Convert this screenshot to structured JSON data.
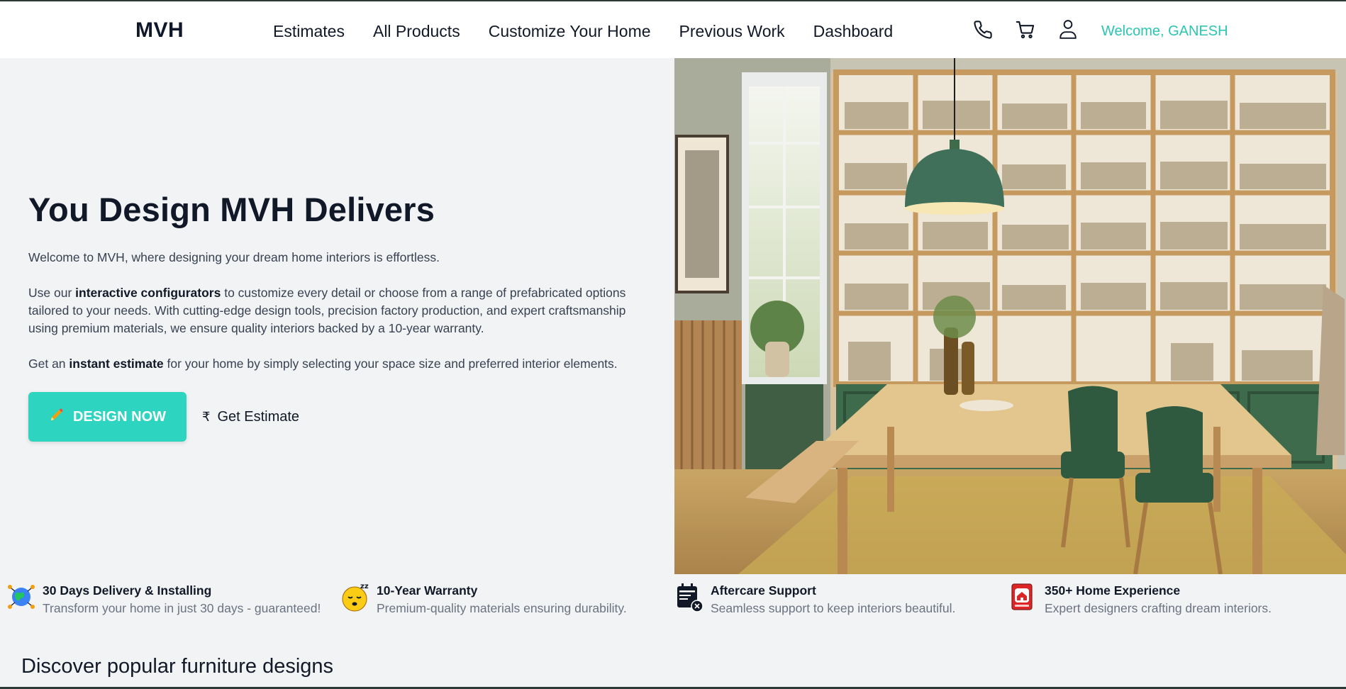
{
  "brand": {
    "logo": "MVH",
    "accent": "#2dd4bf"
  },
  "nav": {
    "items": [
      {
        "label": "Estimates"
      },
      {
        "label": "All Products"
      },
      {
        "label": "Customize Your Home"
      },
      {
        "label": "Previous Work"
      },
      {
        "label": "Dashboard"
      }
    ]
  },
  "header": {
    "icons": [
      "phone-icon",
      "cart-icon",
      "user-icon"
    ],
    "welcome": "Welcome, GANESH"
  },
  "hero": {
    "title": "You Design MVH Delivers",
    "p1": "Welcome to MVH, where designing your dream home interiors is effortless.",
    "p2_pre": "Use our ",
    "p2_bold": "interactive configurators",
    "p2_post": " to customize every detail or choose from a range of prefabricated options tailored to your needs. With cutting-edge design tools, precision factory production, and expert craftsmanship using premium materials, we ensure quality interiors backed by a 10-year warranty.",
    "p3_pre": "Get an ",
    "p3_bold": "instant estimate",
    "p3_post": " for your home by simply selecting your space size and preferred interior elements.",
    "design_button": "DESIGN NOW",
    "estimate_symbol": "₹",
    "estimate_button": "Get Estimate"
  },
  "features": [
    {
      "icon": "globe-delivery-icon",
      "title": "30 Days Delivery & Installing",
      "desc": "Transform your home in just 30 days - guaranteed!"
    },
    {
      "icon": "sleeping-face-icon",
      "title": "10-Year Warranty",
      "desc": "Premium-quality materials ensuring durability."
    },
    {
      "icon": "calendar-support-icon",
      "title": "Aftercare Support",
      "desc": "Seamless support to keep interiors beautiful."
    },
    {
      "icon": "home-book-icon",
      "title": "350+ Home Experience",
      "desc": "Expert designers crafting dream interiors."
    }
  ],
  "section": {
    "title": "Discover popular furniture designs"
  }
}
